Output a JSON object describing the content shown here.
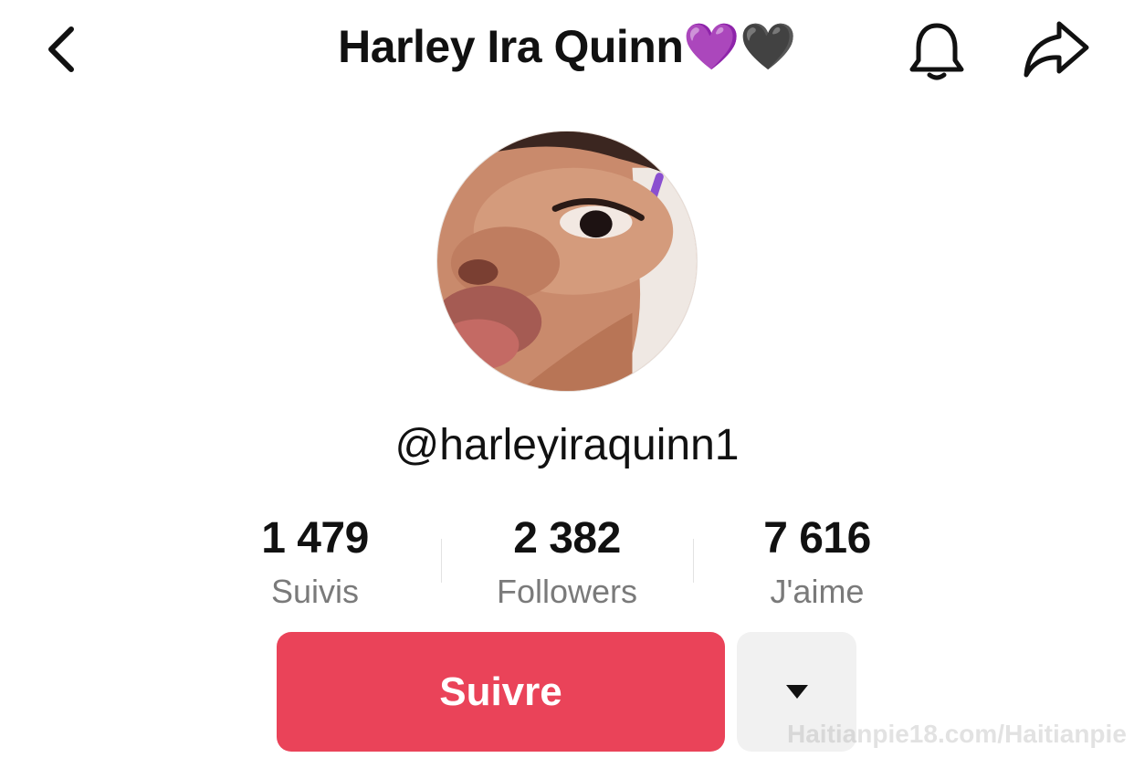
{
  "header": {
    "title": "Harley Ira Quinn💜🖤",
    "back_icon": "chevron-left-icon",
    "bell_icon": "bell-icon",
    "share_icon": "share-arrow-icon"
  },
  "profile": {
    "handle": "@harleyiraquinn1"
  },
  "stats": [
    {
      "value": "1 479",
      "label": "Suivis"
    },
    {
      "value": "2 382",
      "label": "Followers"
    },
    {
      "value": "7 616",
      "label": "J'aime"
    }
  ],
  "actions": {
    "follow_label": "Suivre",
    "more_icon": "caret-down-icon"
  },
  "watermark": "Haitianpie18.com/Haitianpie",
  "colors": {
    "accent": "#ea4359",
    "secondary_button": "#f1f1f1",
    "muted_text": "#7a7a7a"
  }
}
